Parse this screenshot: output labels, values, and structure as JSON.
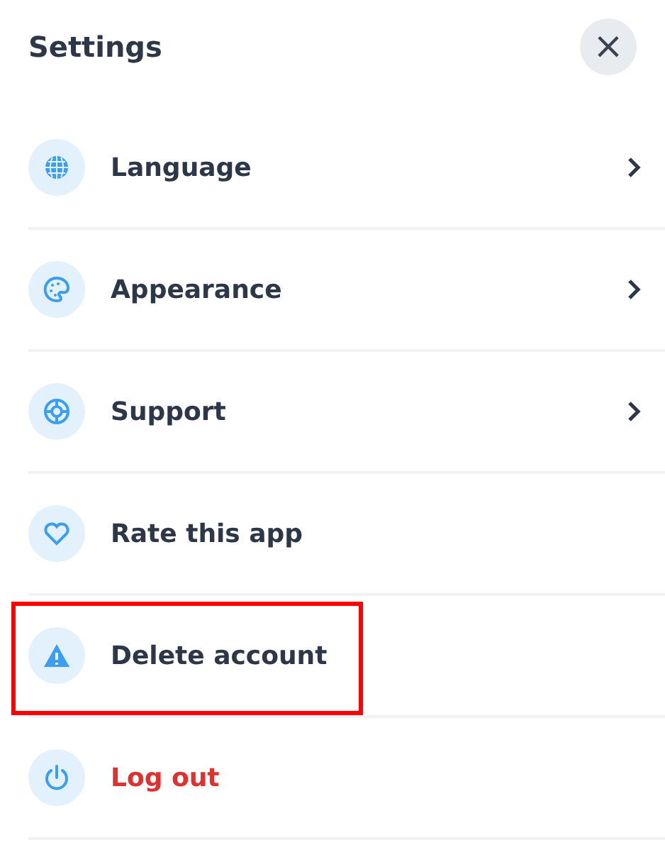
{
  "title": "Settings",
  "close": {
    "label": "×"
  },
  "items": [
    {
      "label": "Language",
      "chevron": true,
      "danger": false,
      "highlighted": false
    },
    {
      "label": "Appearance",
      "chevron": true,
      "danger": false,
      "highlighted": false
    },
    {
      "label": "Support",
      "chevron": true,
      "danger": false,
      "highlighted": false
    },
    {
      "label": "Rate this app",
      "chevron": false,
      "danger": false,
      "highlighted": false
    },
    {
      "label": "Delete account",
      "chevron": false,
      "danger": false,
      "highlighted": true
    },
    {
      "label": "Log out",
      "chevron": false,
      "danger": true,
      "highlighted": false
    }
  ]
}
